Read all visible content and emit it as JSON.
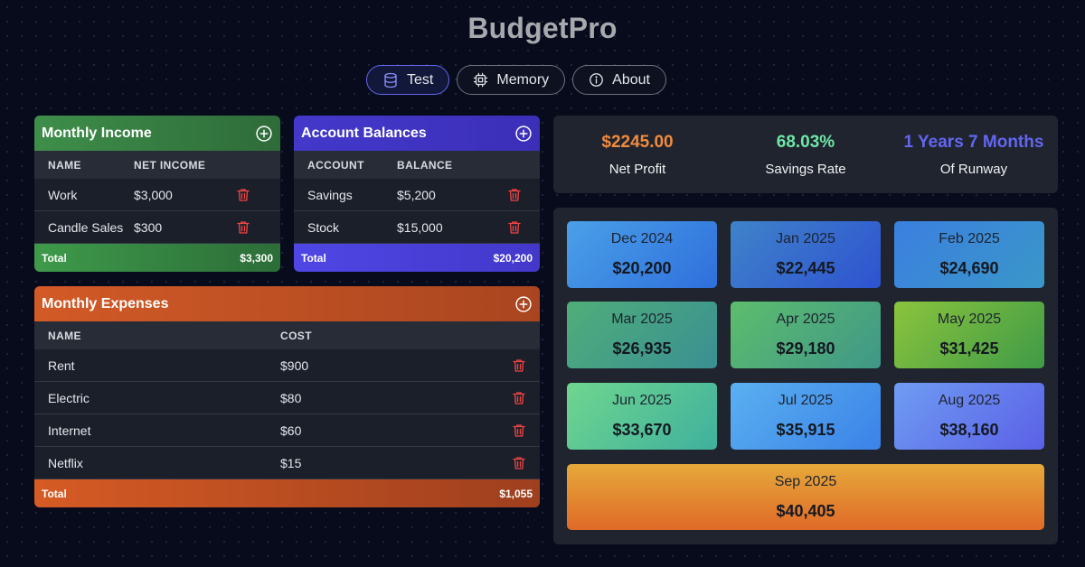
{
  "app": {
    "title": "BudgetPro"
  },
  "nav": [
    {
      "label": "Test",
      "icon": "database-icon",
      "active": true
    },
    {
      "label": "Memory",
      "icon": "chip-icon",
      "active": false
    },
    {
      "label": "About",
      "icon": "info-icon",
      "active": false
    }
  ],
  "income": {
    "title": "Monthly Income",
    "columns": [
      "NAME",
      "NET INCOME"
    ],
    "rows": [
      {
        "name": "Work",
        "value": "$3,000"
      },
      {
        "name": "Candle Sales",
        "value": "$300"
      }
    ],
    "total_label": "Total",
    "total_value": "$3,300"
  },
  "accounts": {
    "title": "Account Balances",
    "columns": [
      "ACCOUNT",
      "BALANCE"
    ],
    "rows": [
      {
        "name": "Savings",
        "value": "$5,200"
      },
      {
        "name": "Stock",
        "value": "$15,000"
      }
    ],
    "total_label": "Total",
    "total_value": "$20,200"
  },
  "expenses": {
    "title": "Monthly Expenses",
    "columns": [
      "NAME",
      "COST"
    ],
    "rows": [
      {
        "name": "Rent",
        "value": "$900"
      },
      {
        "name": "Electric",
        "value": "$80"
      },
      {
        "name": "Internet",
        "value": "$60"
      },
      {
        "name": "Netflix",
        "value": "$15"
      }
    ],
    "total_label": "Total",
    "total_value": "$1,055"
  },
  "stats": [
    {
      "value": "$2245.00",
      "label": "Net Profit",
      "color": "#f08a3e"
    },
    {
      "value": "68.03%",
      "label": "Savings Rate",
      "color": "#6ee7a8"
    },
    {
      "value": "1 Years 7 Months",
      "label": "Of Runway",
      "color": "#6366f1"
    }
  ],
  "forecast": [
    {
      "month": "Dec 2024",
      "amount": "$20,200"
    },
    {
      "month": "Jan 2025",
      "amount": "$22,445"
    },
    {
      "month": "Feb 2025",
      "amount": "$24,690"
    },
    {
      "month": "Mar 2025",
      "amount": "$26,935"
    },
    {
      "month": "Apr 2025",
      "amount": "$29,180"
    },
    {
      "month": "May 2025",
      "amount": "$31,425"
    },
    {
      "month": "Jun 2025",
      "amount": "$33,670"
    },
    {
      "month": "Jul 2025",
      "amount": "$35,915"
    },
    {
      "month": "Aug 2025",
      "amount": "$38,160"
    },
    {
      "month": "Sep 2025",
      "amount": "$40,405"
    }
  ],
  "colors": {
    "income": "#3e8e4a",
    "accounts": "#4338ca",
    "expenses": "#d25a26",
    "delete": "#ef4444"
  }
}
